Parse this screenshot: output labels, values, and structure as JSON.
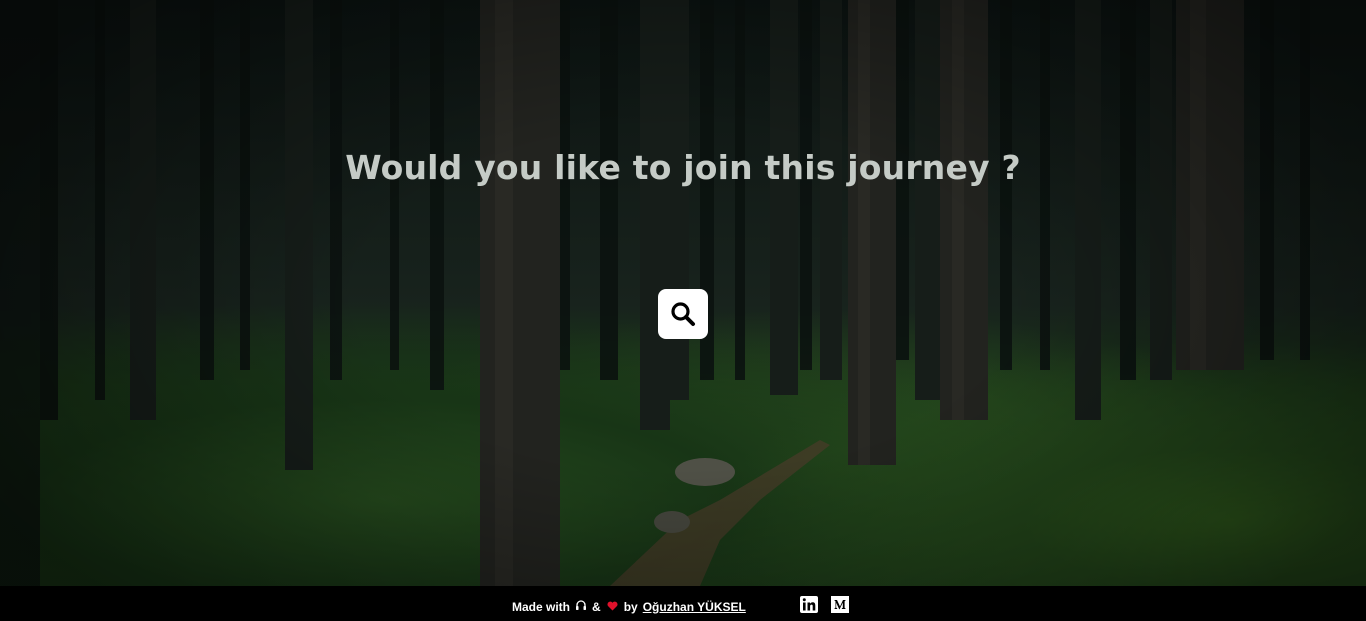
{
  "hero": {
    "title": "Would you like to join this journey ?",
    "search_icon": "search-icon"
  },
  "footer": {
    "made_with": "Made with",
    "headphones_icon": "headphones-icon",
    "ampersand": "&",
    "heart_icon": "heart-icon",
    "by": "by",
    "author": "Oğuzhan YÜKSEL",
    "linkedin_icon": "linkedin-icon",
    "medium_icon": "medium-icon"
  },
  "colors": {
    "footer_bg": "#000000",
    "heart": "#e0112b",
    "title": "#c5cbc6"
  }
}
